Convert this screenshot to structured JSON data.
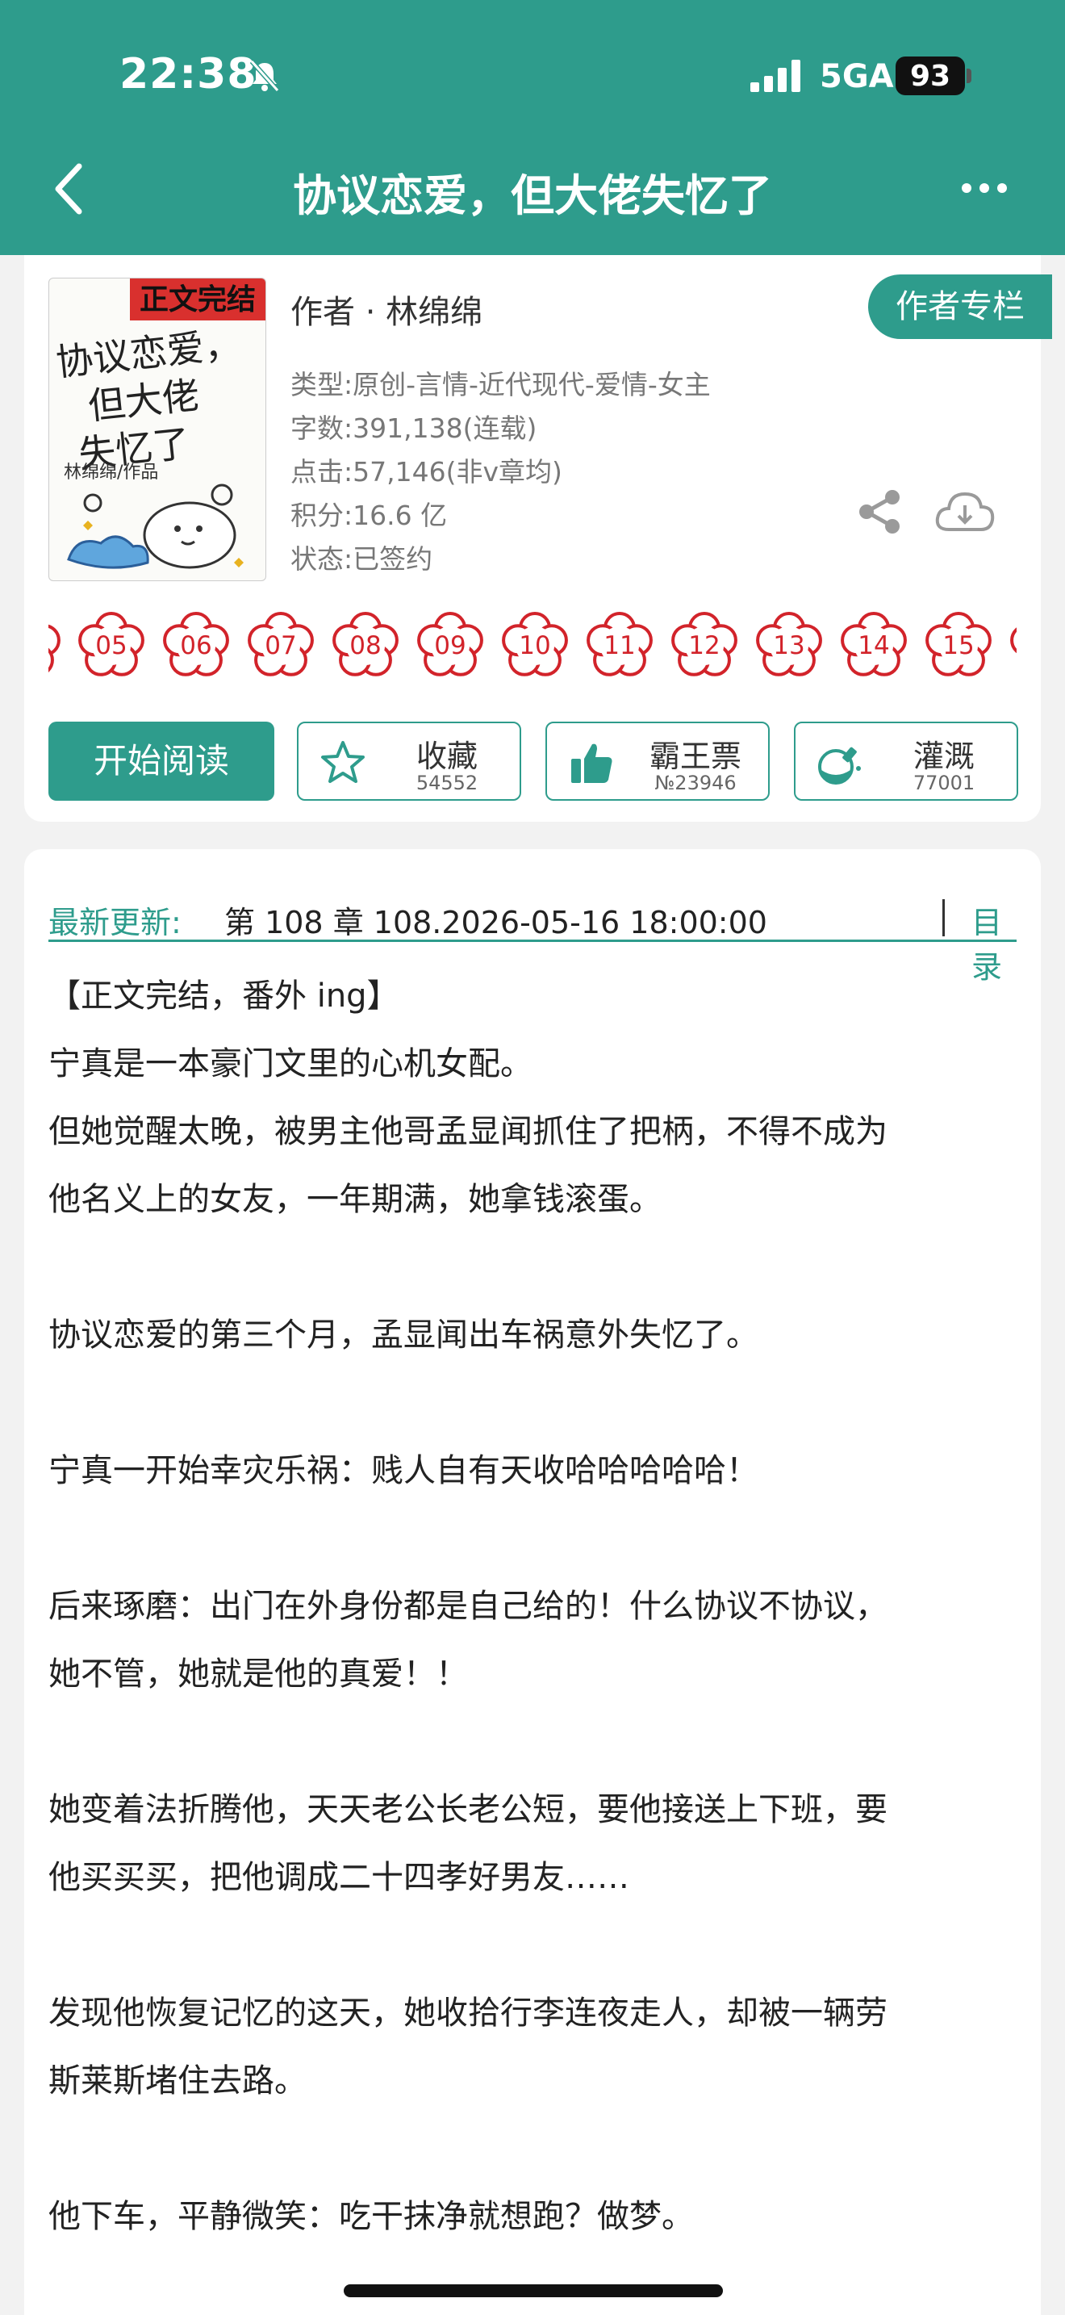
{
  "status_bar": {
    "time": "22:38",
    "carrier": "5GA",
    "battery": "93"
  },
  "nav": {
    "title": "协议恋爱，但大佬失忆了",
    "back_icon": "chevron-left-icon",
    "more_icon": "ellipsis-icon"
  },
  "colors": {
    "accent": "#2e9c8c",
    "flower": "#d2232a",
    "badge": "#d9302e"
  },
  "book": {
    "cover": {
      "badge": "正文完结",
      "title_line1": "协议恋爱，",
      "title_line2": "但大佬",
      "title_line3": "失忆了",
      "author_sign": "林绵绵/作品"
    },
    "author": "作者 · 林绵绵",
    "author_column": "作者专栏",
    "type": "类型:原创-言情-近代现代-爱情-女主",
    "word_count": "字数:391,138(连载)",
    "clicks": "点击:57,146(非v章均)",
    "points": "积分:16.6 亿",
    "status": "状态:已签约"
  },
  "flowers": [
    "05",
    "06",
    "07",
    "08",
    "09",
    "10",
    "11",
    "12",
    "13",
    "14",
    "15"
  ],
  "actions": {
    "read": "开始阅读",
    "favorite": {
      "label": "收藏",
      "count": "54552",
      "icon": "star-icon"
    },
    "ticket": {
      "label": "霸王票",
      "count": "№23946",
      "icon": "thumbs-up-icon"
    },
    "nutrient": {
      "label": "灌溉",
      "count": "77001",
      "icon": "nutrient-bottle-icon"
    }
  },
  "update": {
    "label": "最新更新:",
    "text": "第 108 章 108.2026-05-16 18:00:00",
    "toc": "目录"
  },
  "intro": {
    "l1": "【正文完结，番外 ing】",
    "l2": "宁真是一本豪门文里的心机女配。",
    "l3": "但她觉醒太晚，被男主他哥孟显闻抓住了把柄，不得不成为",
    "l4": "他名义上的女友，一年期满，她拿钱滚蛋。",
    "l5": "协议恋爱的第三个月，孟显闻出车祸意外失忆了。",
    "l6": "宁真一开始幸灾乐祸：贱人自有天收哈哈哈哈哈！",
    "l7": "后来琢磨：出门在外身份都是自己给的！什么协议不协议，",
    "l8": "她不管，她就是他的真爱！！",
    "l9": "她变着法折腾他，天天老公长老公短，要他接送上下班，要",
    "l10": "他买买买，把他调成二十四孝好男友……",
    "l11": "发现他恢复记忆的这天，她收拾行李连夜走人，却被一辆劳",
    "l12": "斯莱斯堵住去路。",
    "l13": "他下车，平静微笑：吃干抹净就想跑？做梦。"
  }
}
